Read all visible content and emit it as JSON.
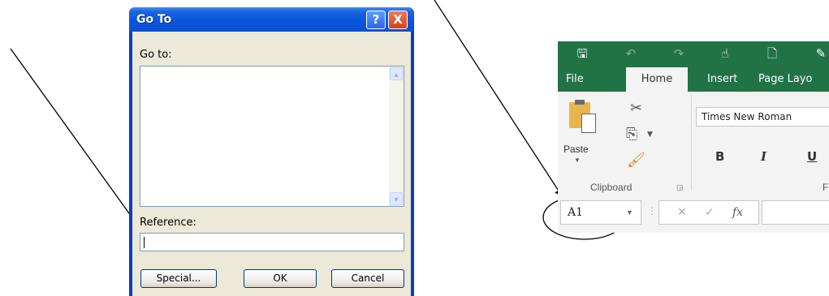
{
  "goto_dialog": {
    "title": "Go To",
    "help_button": "?",
    "close_button": "X",
    "goto_label": "Go to:",
    "reference_label": "Reference:",
    "reference_value": "",
    "buttons": {
      "special": "Special...",
      "ok": "OK",
      "cancel": "Cancel"
    }
  },
  "excel": {
    "quick_access": [
      "save-icon",
      "undo-icon",
      "redo-icon",
      "touch-mode-icon",
      "print-preview-icon"
    ],
    "tabs": [
      "File",
      "Home",
      "Insert",
      "Page Layo"
    ],
    "active_tab": "Home",
    "clipboard": {
      "paste_label": "Paste",
      "group_label": "Clipboard"
    },
    "font": {
      "name": "Times New Roman",
      "bold": "B",
      "italic": "I",
      "underline": "U",
      "group_label": "F"
    },
    "formula_bar": {
      "name_box": "A1",
      "fx": "fx"
    }
  }
}
